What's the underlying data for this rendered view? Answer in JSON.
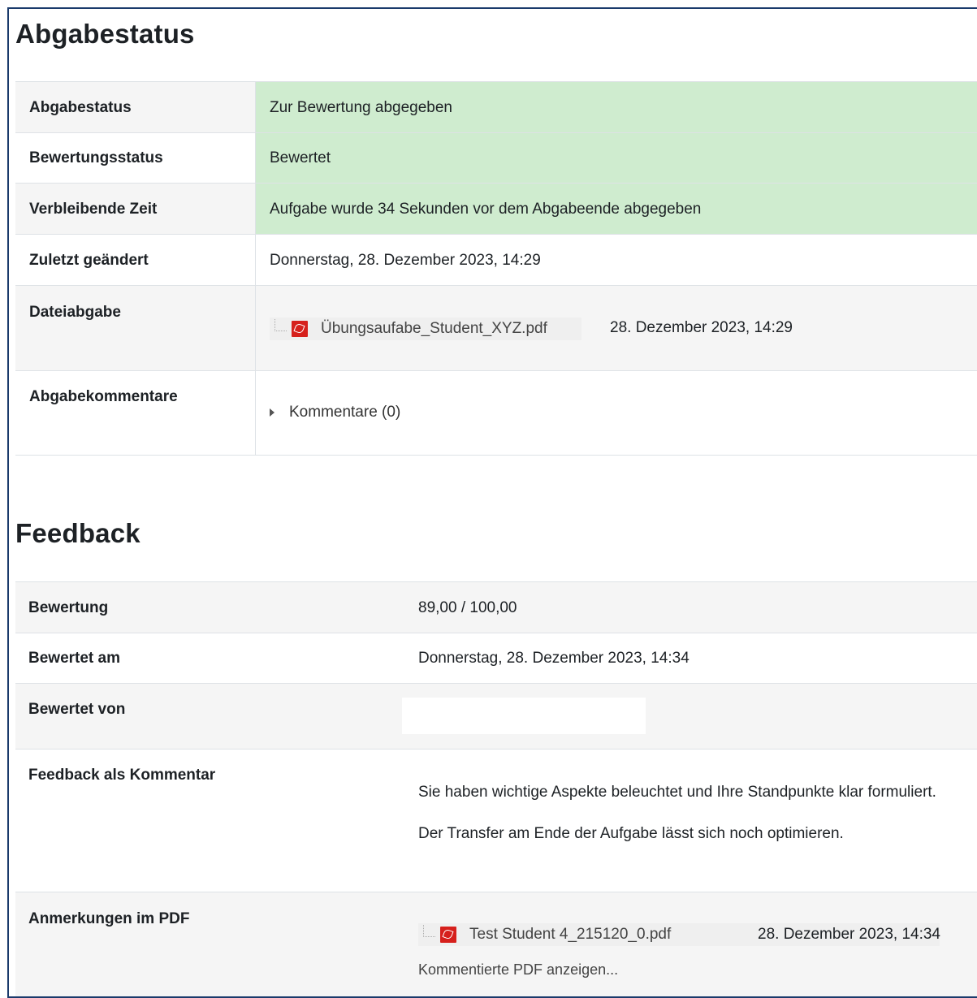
{
  "submission": {
    "heading": "Abgabestatus",
    "rows": [
      {
        "label": "Abgabestatus",
        "value": "Zur Bewertung abgegeben"
      },
      {
        "label": "Bewertungsstatus",
        "value": "Bewertet"
      },
      {
        "label": "Verbleibende Zeit",
        "value": "Aufgabe wurde 34 Sekunden vor dem Abgabeende abgegeben"
      },
      {
        "label": "Zuletzt geändert",
        "value": "Donnerstag, 28. Dezember 2023, 14:29"
      },
      {
        "label": "Dateiabgabe",
        "file_name": "Übungsaufabe_Student_XYZ.pdf",
        "file_date": "28. Dezember 2023, 14:29"
      },
      {
        "label": "Abgabekommentare",
        "comments_label": "Kommentare (0)"
      }
    ],
    "status_color": "#cfeccf"
  },
  "feedback": {
    "heading": "Feedback",
    "rows": [
      {
        "label": "Bewertung",
        "value": "89,00 / 100,00"
      },
      {
        "label": "Bewertet am",
        "value": "Donnerstag, 28. Dezember 2023, 14:34"
      },
      {
        "label": "Bewertet von",
        "value": ""
      },
      {
        "label": "Feedback als Kommentar",
        "lines": [
          "Sie haben wichtige Aspekte beleuchtet und Ihre Standpunkte klar formuliert.",
          "Der Transfer am Ende der Aufgabe lässt sich noch optimieren."
        ]
      },
      {
        "label": "Anmerkungen im PDF",
        "file_name": "Test Student 4_215120_0.pdf",
        "file_date": "28. Dezember 2023, 14:34",
        "link": "Kommentierte PDF anzeigen..."
      }
    ]
  },
  "icons": {
    "pdf": "pdf-file-icon",
    "expand": "expand-triangle-icon"
  }
}
